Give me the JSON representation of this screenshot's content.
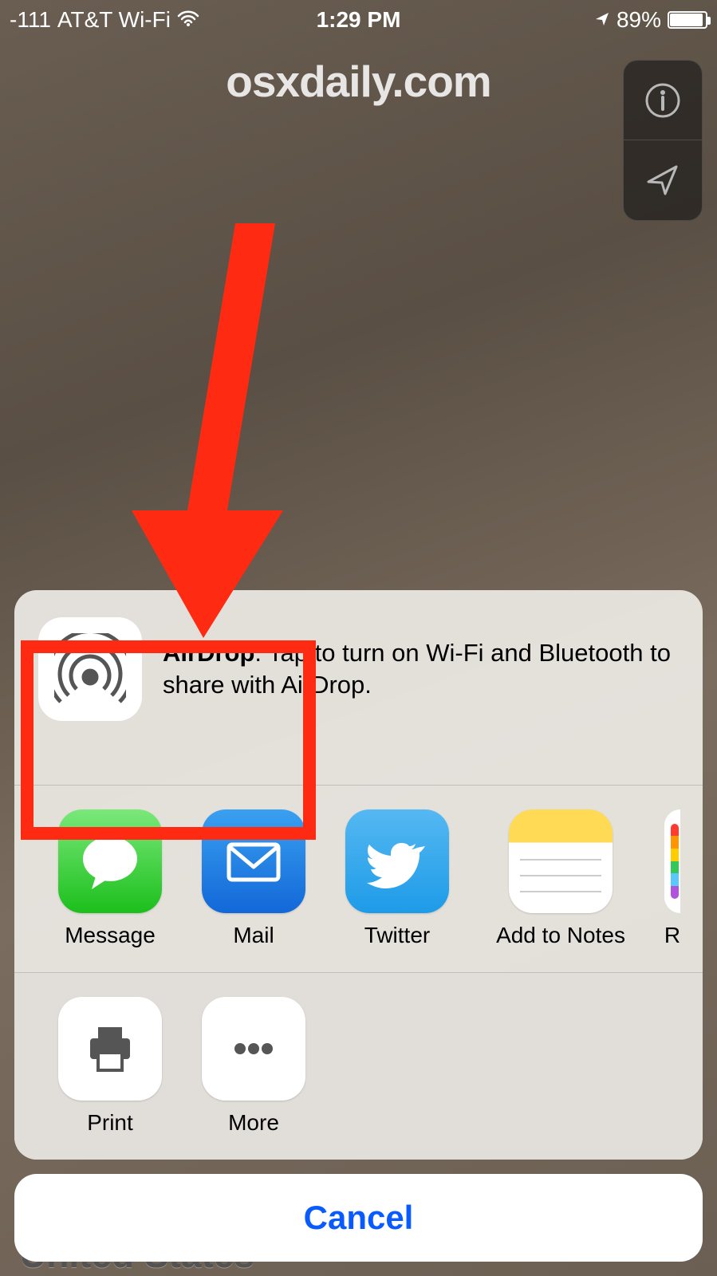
{
  "status": {
    "signal": "-111",
    "carrier": "AT&T Wi-Fi",
    "time": "1:29 PM",
    "battery_pct": "89%"
  },
  "watermark": "osxdaily.com",
  "bottom_peek": "United States",
  "airdrop": {
    "title": "AirDrop",
    "desc_prefix": ". Tap to turn on Wi-Fi and Bluetooth to share with AirDrop."
  },
  "apps": [
    {
      "label": "Message"
    },
    {
      "label": "Mail"
    },
    {
      "label": "Twitter"
    },
    {
      "label": "Add to Notes"
    },
    {
      "label_partial": "R"
    }
  ],
  "actions": [
    {
      "label": "Print"
    },
    {
      "label": "More"
    }
  ],
  "cancel": "Cancel"
}
